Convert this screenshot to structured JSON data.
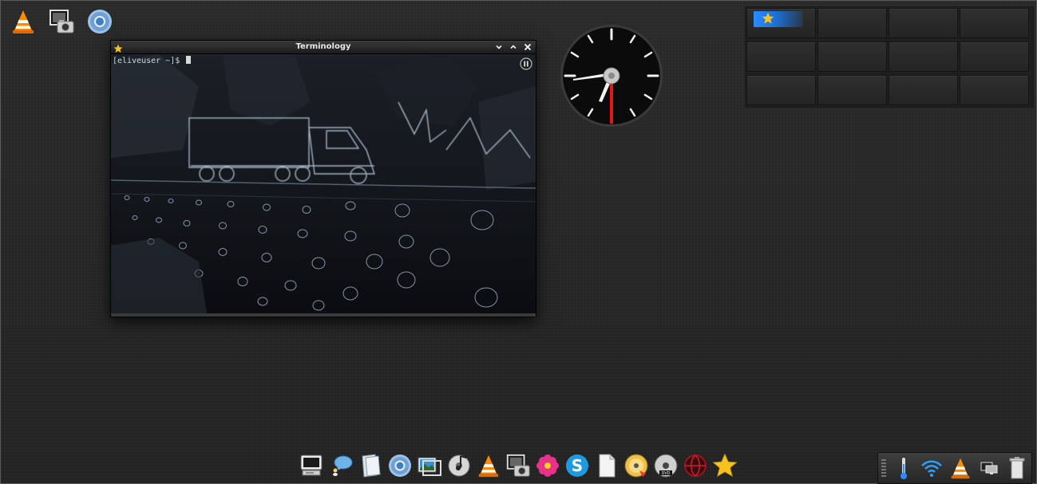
{
  "desktop": {
    "icons": [
      "vlc-icon",
      "screenshot-icon",
      "chromium-icon"
    ]
  },
  "terminal": {
    "title": "Terminology",
    "prompt": "[eliveuser ~]$ "
  },
  "pager": {
    "desks": 12,
    "active_desk": 1
  },
  "dock": {
    "items": [
      "computer-icon",
      "messenger-icon",
      "file-manager-icon",
      "chromium-icon",
      "image-viewer-icon",
      "music-player-icon",
      "vlc-icon",
      "screenshot-icon",
      "flower-icon",
      "skype-icon",
      "document-icon",
      "disc-burner-icon",
      "dvd-player-icon",
      "network-globe-icon",
      "star-icon"
    ]
  },
  "tray": {
    "items": [
      "temperature-icon",
      "wifi-icon",
      "vlc-icon",
      "display-icon",
      "trash-icon"
    ]
  },
  "colors": {
    "accent": "#2a8cff",
    "clock_hand": "#e01818"
  }
}
